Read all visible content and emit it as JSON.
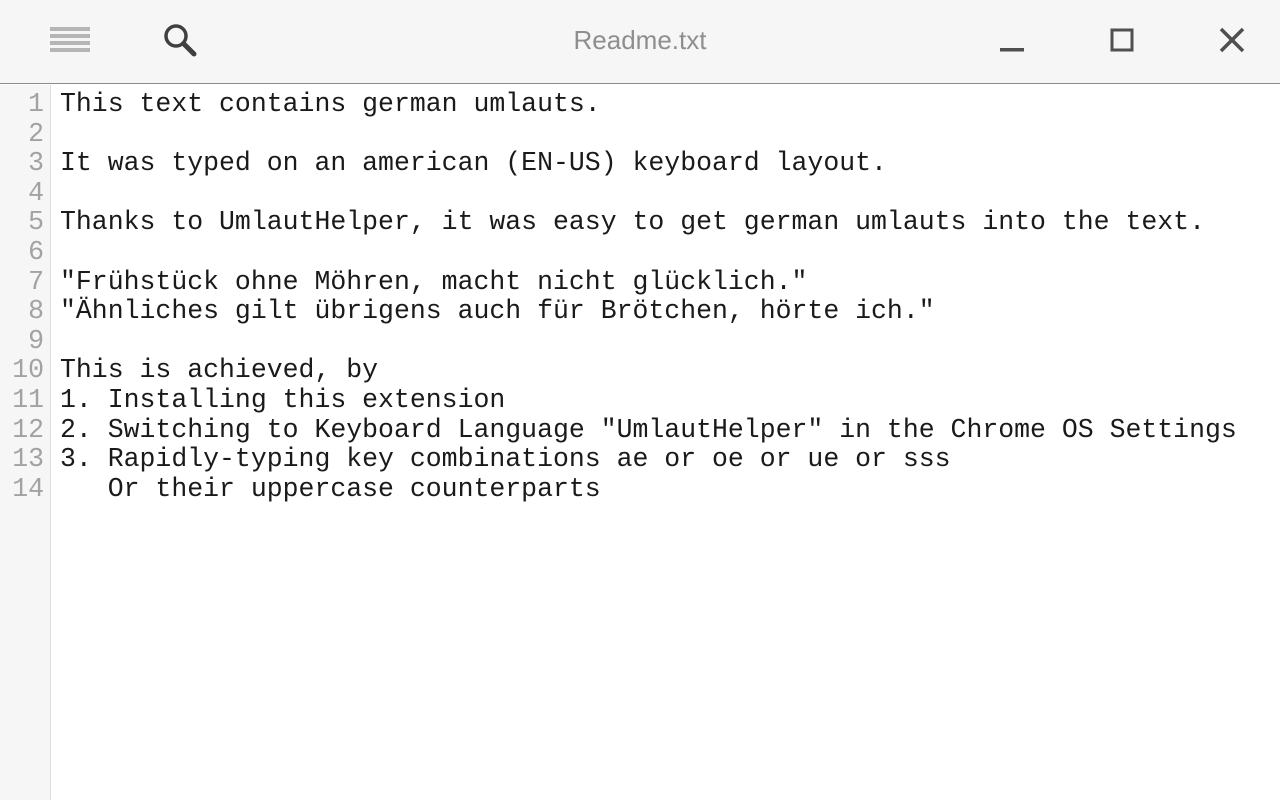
{
  "window": {
    "title": "Readme.txt"
  },
  "toolbar": {
    "menu_icon": "hamburger-menu-icon",
    "search_icon": "search-icon",
    "minimize_icon": "minimize-icon",
    "maximize_icon": "maximize-icon",
    "close_icon": "close-icon"
  },
  "editor": {
    "lines": [
      {
        "number": "1",
        "text": "This text contains german umlauts."
      },
      {
        "number": "2",
        "text": ""
      },
      {
        "number": "3",
        "text": "It was typed on an american (EN-US) keyboard layout."
      },
      {
        "number": "4",
        "text": ""
      },
      {
        "number": "5",
        "text": "Thanks to UmlautHelper, it was easy to get german umlauts into the text."
      },
      {
        "number": "6",
        "text": ""
      },
      {
        "number": "7",
        "text": "\"Frühstück ohne Möhren, macht nicht glücklich.\""
      },
      {
        "number": "8",
        "text": "\"Ähnliches gilt übrigens auch für Brötchen, hörte ich.\""
      },
      {
        "number": "9",
        "text": ""
      },
      {
        "number": "10",
        "text": "This is achieved, by"
      },
      {
        "number": "11",
        "text": "1. Installing this extension"
      },
      {
        "number": "12",
        "text": "2. Switching to Keyboard Language \"UmlautHelper\" in the Chrome OS Settings"
      },
      {
        "number": "13",
        "text": "3. Rapidly-typing key combinations ae or oe or ue or sss"
      },
      {
        "number": "14",
        "text": "   Or their uppercase counterparts"
      }
    ]
  },
  "colors": {
    "titlebar_bg": "#f6f6f6",
    "title_text": "#8e8e8e",
    "line_number": "#a2a2a2",
    "text": "#1a1a1a"
  }
}
